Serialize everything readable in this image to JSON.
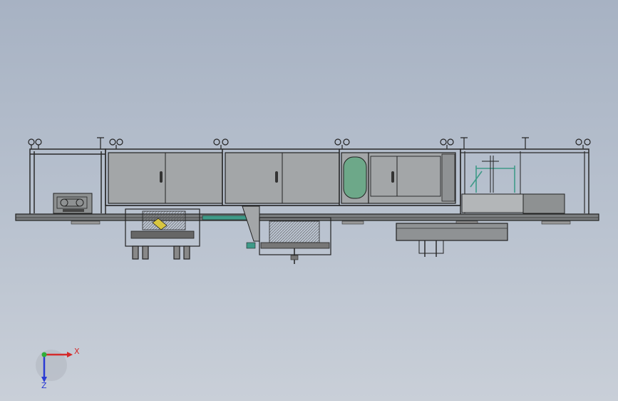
{
  "viewport": {
    "background_top": "#a7b2c3",
    "background_bottom": "#c9cfd8"
  },
  "axis_triad": {
    "x_label": "X",
    "z_label": "Z",
    "x_color": "#d42a2a",
    "y_color": "#2fae38",
    "z_color": "#2a3ad4"
  },
  "machine": {
    "cabinet_color": "#a3a6a8",
    "frame_color": "#3a3a3a",
    "window_color": "#6da889",
    "teal_accent": "#3e9a88"
  }
}
